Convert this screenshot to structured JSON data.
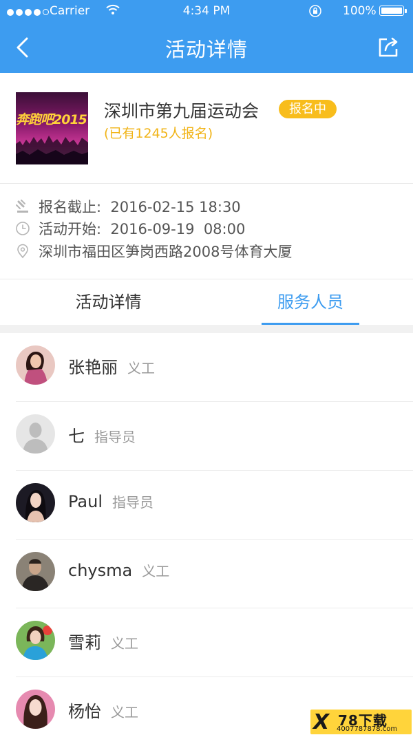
{
  "status_bar": {
    "carrier": "Carrier",
    "time": "4:34 PM",
    "battery": "100%"
  },
  "nav": {
    "title": "活动详情",
    "back_icon": "chevron-left-icon",
    "share_icon": "share-icon"
  },
  "event": {
    "thumbnail_text": "奔跑吧2015",
    "title": "深圳市第九届运动会",
    "status_badge": "报名中",
    "signup_count": "(已有1245人报名)"
  },
  "info": {
    "deadline": "报名截止:  2016-02-15 18:30",
    "start": "活动开始:  2016-09-19  08:00",
    "address": "深圳市福田区笋岗西路2008号体育大厦"
  },
  "tabs": {
    "details": "活动详情",
    "staff": "服务人员",
    "active": "staff"
  },
  "staff": [
    {
      "name": "张艳丽",
      "role": "义工"
    },
    {
      "name": "七",
      "role": "指导员"
    },
    {
      "name": "Paul",
      "role": "指导员"
    },
    {
      "name": "chysma",
      "role": "义工"
    },
    {
      "name": "雪莉",
      "role": "义工"
    },
    {
      "name": "杨怡",
      "role": "义工"
    }
  ],
  "watermark": {
    "mark": "X",
    "title": "78下载",
    "url": "4007787878.com"
  },
  "colors": {
    "primary": "#3d9cf0",
    "badge": "#f8bd1c",
    "count": "#f1b418"
  }
}
